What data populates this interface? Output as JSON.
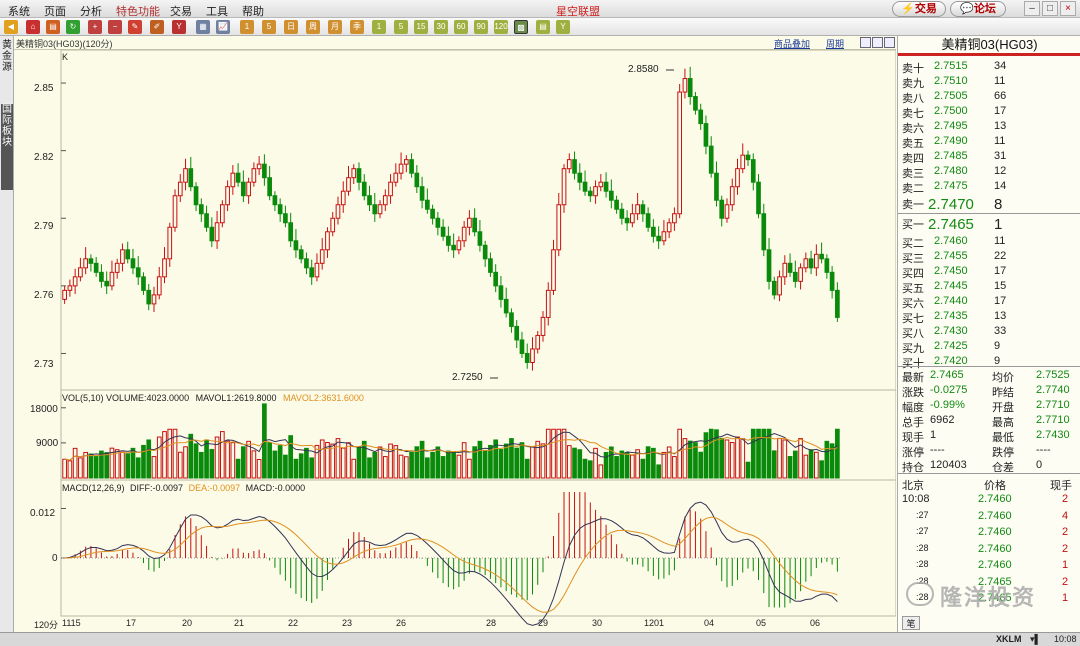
{
  "menu": {
    "items": [
      "系统",
      "页面",
      "分析",
      "特色功能",
      "交易",
      "工具",
      "帮助"
    ],
    "app_title": "星空联盟",
    "trade_btn": "交易",
    "forum_btn": "论坛"
  },
  "sidebar": {
    "tab1": "黄金源",
    "tab2": "国际板块"
  },
  "chart_header": {
    "title": "美精铜03(HG03)(120分)",
    "link_overlay": "商品叠加",
    "link_period": "周期",
    "k_label": "K"
  },
  "price_axis": [
    "2.85",
    "2.82",
    "2.79",
    "2.76",
    "2.73"
  ],
  "vol_axis": [
    "18000",
    "9000"
  ],
  "macd_axis": [
    "0.012",
    "0"
  ],
  "x_axis": {
    "period_label": "120分",
    "ticks": [
      "1115",
      "17",
      "20",
      "21",
      "22",
      "23",
      "26",
      "28",
      "29",
      "30",
      "1201",
      "04",
      "05",
      "06"
    ]
  },
  "annotations": {
    "high": "2.8580",
    "low": "2.7250"
  },
  "volume_legend": {
    "vol": "VOL(5,10) VOLUME:4023.0000",
    "mavol1": "MAVOL1:2619.8000",
    "mavol2": "MAVOL2:3631.6000"
  },
  "macd_legend": {
    "macd": "MACD(12,26,9)",
    "diff": "DIFF:-0.0097",
    "dea": "DEA:-0.0097",
    "macd_val": "MACD:-0.0000"
  },
  "quote": {
    "title": "美精铜03(HG03)",
    "sells": [
      {
        "label": "卖十",
        "price": "2.7515",
        "vol": "34"
      },
      {
        "label": "卖九",
        "price": "2.7510",
        "vol": "11"
      },
      {
        "label": "卖八",
        "price": "2.7505",
        "vol": "66"
      },
      {
        "label": "卖七",
        "price": "2.7500",
        "vol": "17"
      },
      {
        "label": "卖六",
        "price": "2.7495",
        "vol": "13"
      },
      {
        "label": "卖五",
        "price": "2.7490",
        "vol": "11"
      },
      {
        "label": "卖四",
        "price": "2.7485",
        "vol": "31"
      },
      {
        "label": "卖三",
        "price": "2.7480",
        "vol": "12"
      },
      {
        "label": "卖二",
        "price": "2.7475",
        "vol": "14"
      },
      {
        "label": "卖一",
        "price": "2.7470",
        "vol": "8"
      }
    ],
    "buys": [
      {
        "label": "买一",
        "price": "2.7465",
        "vol": "1"
      },
      {
        "label": "买二",
        "price": "2.7460",
        "vol": "11"
      },
      {
        "label": "买三",
        "price": "2.7455",
        "vol": "22"
      },
      {
        "label": "买四",
        "price": "2.7450",
        "vol": "17"
      },
      {
        "label": "买五",
        "price": "2.7445",
        "vol": "15"
      },
      {
        "label": "买六",
        "price": "2.7440",
        "vol": "17"
      },
      {
        "label": "买七",
        "price": "2.7435",
        "vol": "13"
      },
      {
        "label": "买八",
        "price": "2.7430",
        "vol": "33"
      },
      {
        "label": "买九",
        "price": "2.7425",
        "vol": "9"
      },
      {
        "label": "买十",
        "price": "2.7420",
        "vol": "9"
      }
    ],
    "stats": [
      {
        "l1": "最新",
        "v1": "2.7465",
        "l2": "均价",
        "v2": "2.7525"
      },
      {
        "l1": "涨跌",
        "v1": "-0.0275",
        "l2": "昨结",
        "v2": "2.7740"
      },
      {
        "l1": "幅度",
        "v1": "-0.99%",
        "l2": "开盘",
        "v2": "2.7710"
      },
      {
        "l1": "总手",
        "v1": "6962",
        "l2": "最高",
        "v2": "2.7710"
      },
      {
        "l1": "现手",
        "v1": "1",
        "l2": "最低",
        "v2": "2.7430"
      },
      {
        "l1": "涨停",
        "v1": "----",
        "l2": "跌停",
        "v2": "----"
      },
      {
        "l1": "持仓",
        "v1": "120403",
        "l2": "仓差",
        "v2": "0"
      }
    ],
    "ticks_header": {
      "c1": "北京",
      "c2": "价格",
      "c3": "现手"
    },
    "ticks": [
      {
        "time": "10:08",
        "price": "2.7460",
        "vol": "2"
      },
      {
        "time": ":27",
        "price": "2.7460",
        "vol": "4"
      },
      {
        "time": ":27",
        "price": "2.7460",
        "vol": "2"
      },
      {
        "time": ":28",
        "price": "2.7460",
        "vol": "2"
      },
      {
        "time": ":28",
        "price": "2.7460",
        "vol": "1"
      },
      {
        "time": ":28",
        "price": "2.7465",
        "vol": "2"
      },
      {
        "time": ":28",
        "price": "2.7465",
        "vol": "1"
      }
    ],
    "tab_label": "笔"
  },
  "status": {
    "brand": "XKLM",
    "time": "10:08"
  },
  "watermark": "隆洋投资",
  "colors": {
    "up": "#c81010",
    "down": "#0a8a0a",
    "ma_dark": "#333355",
    "ma_orange": "#e09020",
    "background": "#fbfbe8"
  },
  "chart_data": {
    "type": "candlestick",
    "title": "美精铜03(HG03)(120分)",
    "x_ticks": [
      "1115",
      "17",
      "20",
      "21",
      "22",
      "23",
      "26",
      "28",
      "29",
      "30",
      "1201",
      "04",
      "05",
      "06"
    ],
    "ylim": [
      2.72,
      2.862
    ],
    "y_ticks": [
      2.73,
      2.76,
      2.79,
      2.82,
      2.85
    ],
    "close": [
      2.758,
      2.76,
      2.764,
      2.768,
      2.772,
      2.77,
      2.766,
      2.762,
      2.76,
      2.766,
      2.77,
      2.776,
      2.772,
      2.768,
      2.764,
      2.758,
      2.752,
      2.756,
      2.764,
      2.772,
      2.786,
      2.8,
      2.806,
      2.812,
      2.804,
      2.796,
      2.792,
      2.786,
      2.78,
      2.788,
      2.796,
      2.804,
      2.81,
      2.806,
      2.8,
      2.806,
      2.812,
      2.814,
      2.808,
      2.8,
      2.796,
      2.792,
      2.788,
      2.78,
      2.776,
      2.772,
      2.768,
      2.764,
      2.77,
      2.776,
      2.784,
      2.79,
      2.796,
      2.802,
      2.808,
      2.812,
      2.806,
      2.8,
      2.796,
      2.792,
      2.796,
      2.8,
      2.806,
      2.81,
      2.814,
      2.816,
      2.81,
      2.804,
      2.798,
      2.794,
      2.79,
      2.786,
      2.782,
      2.778,
      2.776,
      2.78,
      2.786,
      2.79,
      2.784,
      2.778,
      2.772,
      2.766,
      2.76,
      2.754,
      2.748,
      2.742,
      2.736,
      2.73,
      2.726,
      2.732,
      2.738,
      2.746,
      2.758,
      2.776,
      2.796,
      2.812,
      2.816,
      2.81,
      2.806,
      2.802,
      2.8,
      2.804,
      2.806,
      2.802,
      2.798,
      2.794,
      2.79,
      2.788,
      2.792,
      2.796,
      2.792,
      2.786,
      2.782,
      2.78,
      2.784,
      2.788,
      2.792,
      2.846,
      2.852,
      2.844,
      2.838,
      2.832,
      2.822,
      2.81,
      2.798,
      2.79,
      2.796,
      2.804,
      2.812,
      2.818,
      2.816,
      2.806,
      2.792,
      2.776,
      2.762,
      2.756,
      2.764,
      2.77,
      2.766,
      2.762,
      2.768,
      2.772,
      2.768,
      2.774,
      2.772,
      2.766,
      2.758,
      2.746
    ],
    "annotations": [
      {
        "label": "2.8580"
      },
      {
        "label": "2.7250"
      }
    ],
    "volume": {
      "ylim": [
        0,
        20000
      ],
      "ticks": [
        9000,
        18000
      ],
      "mavol1": 2619.8,
      "mavol2": 3631.6,
      "last": 4023
    },
    "macd": {
      "ylim": [
        -0.012,
        0.016
      ],
      "ticks": [
        0,
        0.012
      ],
      "diff": -0.0097,
      "dea": -0.0097,
      "macd": 0.0
    }
  }
}
